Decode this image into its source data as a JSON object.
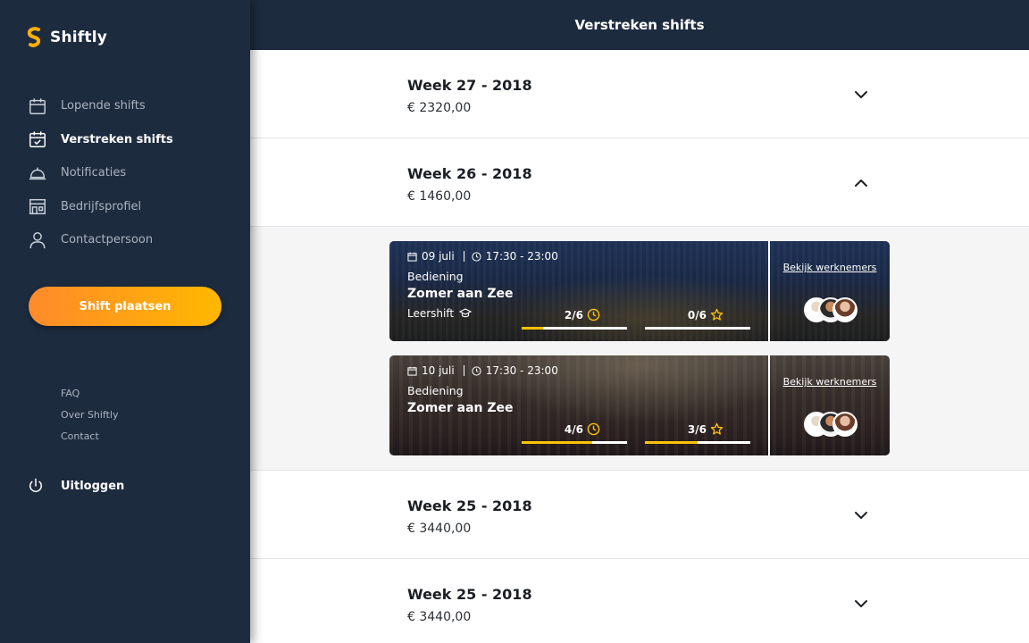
{
  "app": {
    "name": "Shiftly"
  },
  "header": {
    "title": "Verstreken shifts"
  },
  "sidebar": {
    "nav": [
      {
        "label": "Lopende shifts",
        "icon": "calendar-icon",
        "active": false
      },
      {
        "label": "Verstreken shifts",
        "icon": "calendar-check-icon",
        "active": true
      },
      {
        "label": "Notificaties",
        "icon": "cloche-icon",
        "active": false
      },
      {
        "label": "Bedrijfsprofiel",
        "icon": "storefront-icon",
        "active": false
      },
      {
        "label": "Contactpersoon",
        "icon": "user-icon",
        "active": false
      }
    ],
    "cta_label": "Shift plaatsen",
    "links": [
      "FAQ",
      "Over Shiftly",
      "Contact"
    ],
    "logout_label": "Uitloggen"
  },
  "weeks": [
    {
      "title": "Week 27 - 2018",
      "amount": "€ 2320,00",
      "expanded": false
    },
    {
      "title": "Week 26 - 2018",
      "amount": "€ 1460,00",
      "expanded": true
    },
    {
      "title": "Week 25 - 2018",
      "amount": "€ 3440,00",
      "expanded": false
    },
    {
      "title": "Week 25 - 2018",
      "amount": "€ 3440,00",
      "expanded": false
    }
  ],
  "shifts": [
    {
      "date": "09 juli",
      "time": "17:30 - 23:00",
      "role": "Bediening",
      "event": "Zomer aan Zee",
      "tag": "Leershift",
      "filled_label": "2/6",
      "filled_fraction": 0.2,
      "rated_label": "0/6",
      "rated_fraction": 0.0,
      "view_link": "Bekijk werknemers"
    },
    {
      "date": "10 juli",
      "time": "17:30 - 23:00",
      "role": "Bediening",
      "event": "Zomer aan Zee",
      "tag": "",
      "filled_label": "4/6",
      "filled_fraction": 0.67,
      "rated_label": "3/6",
      "rated_fraction": 0.5,
      "view_link": "Bekijk werknemers"
    }
  ],
  "colors": {
    "sidebar": "#1d2b3f",
    "accent_start": "#ff8a2b",
    "accent_end": "#ffb800",
    "progress": "#ffc107"
  }
}
